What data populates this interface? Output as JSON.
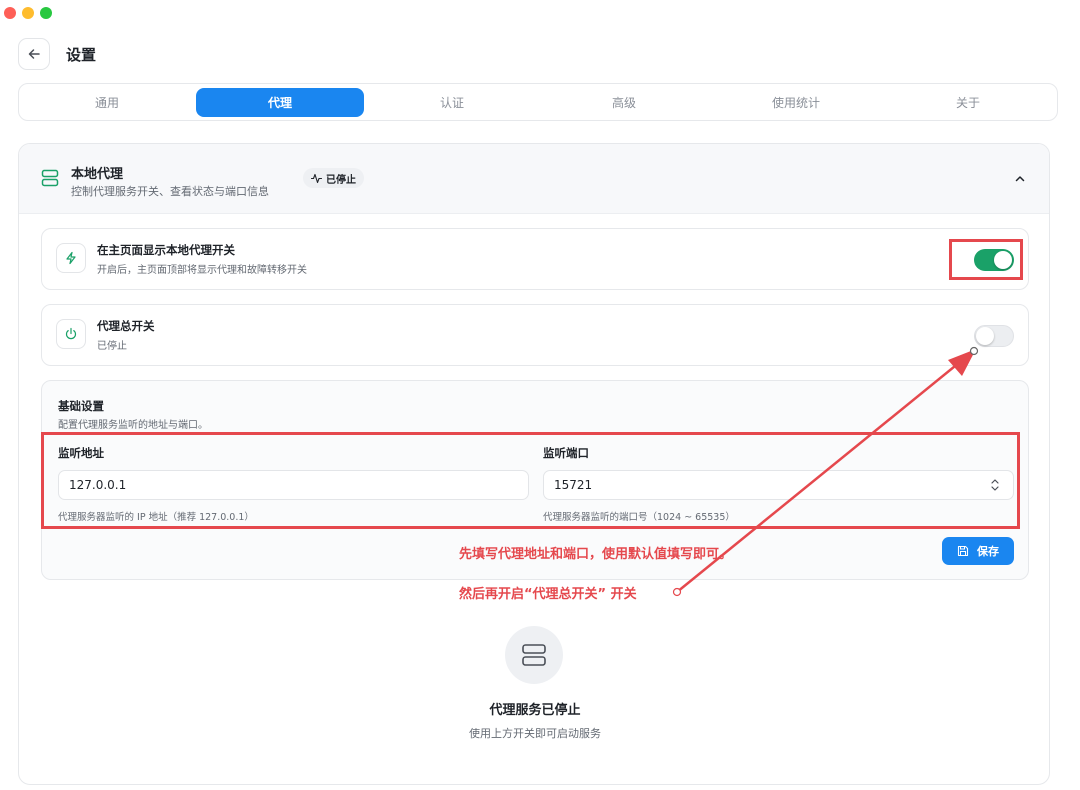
{
  "page": {
    "title": "设置"
  },
  "tabs": [
    {
      "label": "通用",
      "active": false
    },
    {
      "label": "代理",
      "active": true
    },
    {
      "label": "认证",
      "active": false
    },
    {
      "label": "高级",
      "active": false
    },
    {
      "label": "使用统计",
      "active": false
    },
    {
      "label": "关于",
      "active": false
    }
  ],
  "section": {
    "title": "本地代理",
    "subtitle": "控制代理服务开关、查看状态与端口信息",
    "status": "已停止",
    "status_icon": "activity-icon",
    "collapse_icon": "chevron-up-icon"
  },
  "show_toggle_card": {
    "icon": "lightning-icon",
    "title": "在主页面显示本地代理开关",
    "subtitle": "开启后，主页面顶部将显示代理和故障转移开关",
    "enabled": true
  },
  "master_switch_card": {
    "icon": "power-icon",
    "title": "代理总开关",
    "subtitle": "已停止",
    "enabled": false
  },
  "basic_settings": {
    "title": "基础设置",
    "subtitle": "配置代理服务监听的地址与端口。",
    "address": {
      "label": "监听地址",
      "value": "127.0.0.1",
      "hint": "代理服务器监听的 IP 地址（推荐 127.0.0.1）"
    },
    "port": {
      "label": "监听端口",
      "value": "15721",
      "hint": "代理服务器监听的端口号（1024 ~ 65535）"
    },
    "save_label": "保存"
  },
  "annotations": {
    "step1": "先填写代理地址和端口，使用默认值填写即可。",
    "step2": "然后再开启“代理总开关” 开关"
  },
  "empty_state": {
    "icon": "server-icon",
    "title": "代理服务已停止",
    "subtitle": "使用上方开关即可启动服务"
  },
  "colors": {
    "accent": "#1a86f0",
    "toggle_on": "#1aa168",
    "annotation": "#e5484d",
    "section_icon": "#1aa168"
  }
}
